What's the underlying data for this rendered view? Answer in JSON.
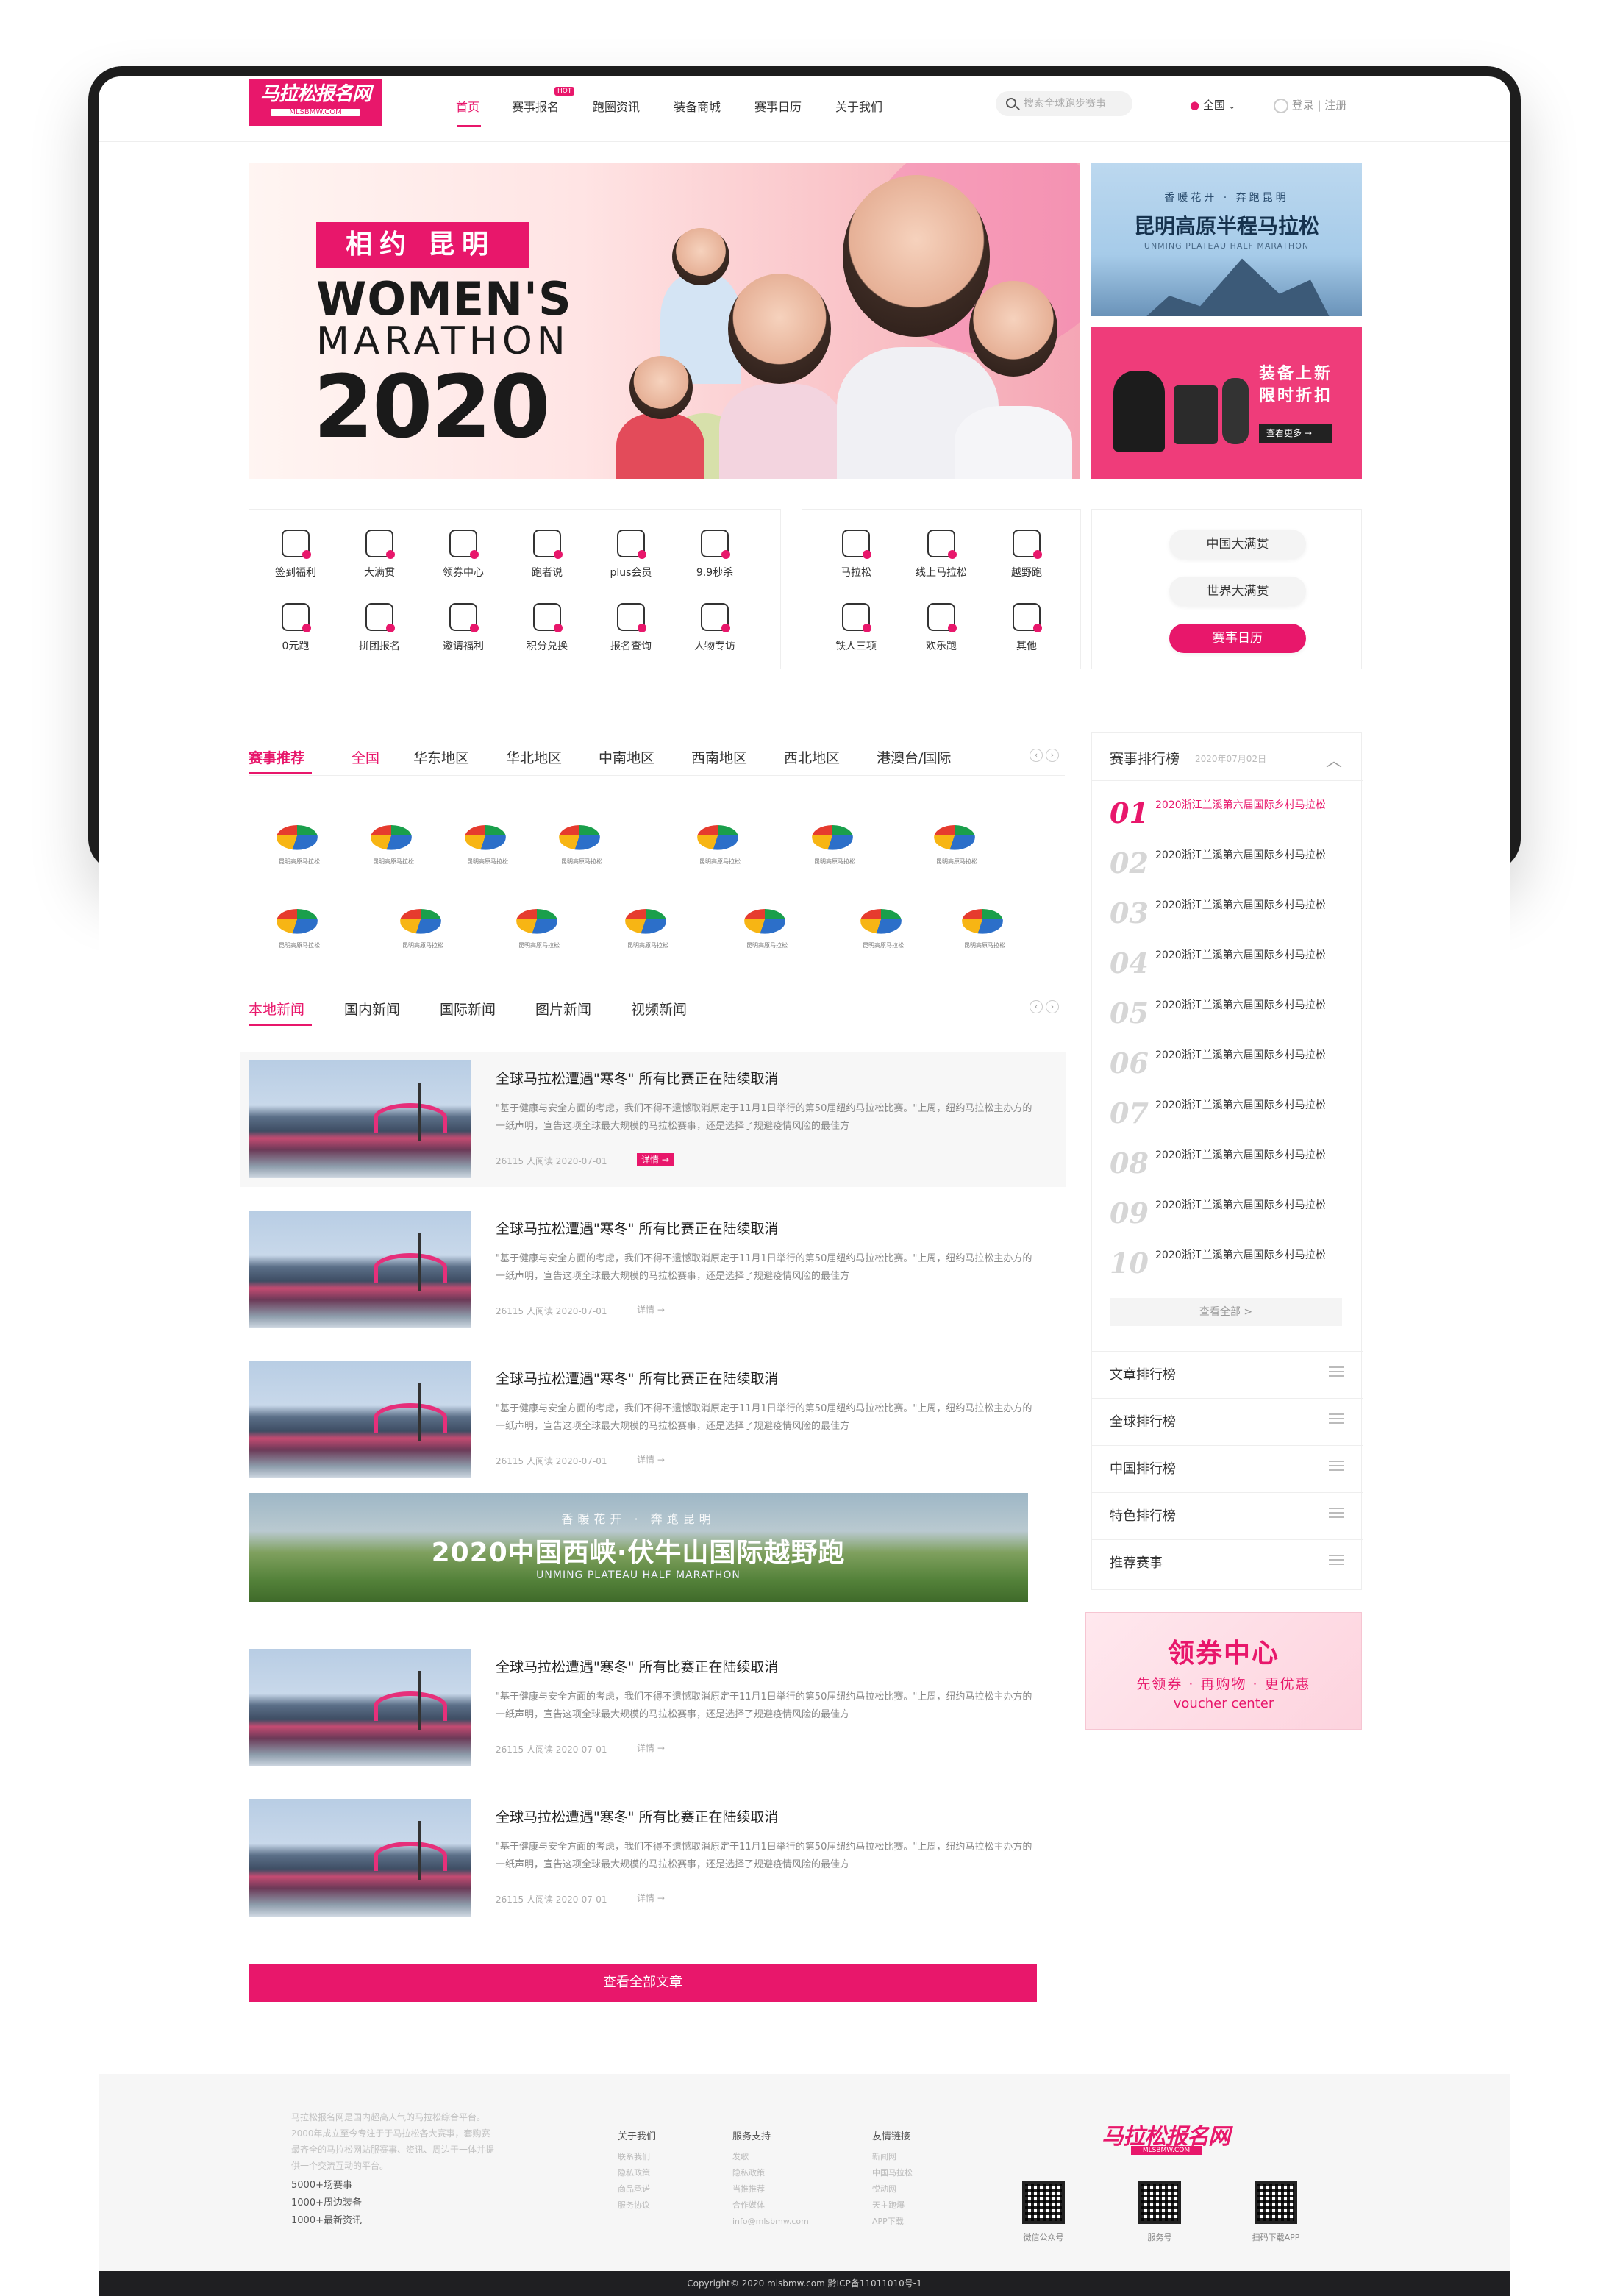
{
  "header": {
    "logo_text": "马拉松报名网",
    "logo_sub": "MLSBMW.COM",
    "nav": [
      "首页",
      "赛事报名",
      "跑圈资讯",
      "装备商城",
      "赛事日历",
      "关于我们"
    ],
    "hot_badge": "HOT",
    "search_placeholder": "搜索全球跑步赛事",
    "location": "全国",
    "login": "登录 | 注册"
  },
  "hero": {
    "tag_left": "相约",
    "tag_right": "昆明",
    "line1": "WOMEN'S",
    "line2": "MARATHON",
    "line3": "2020"
  },
  "side_ads": {
    "ad1_slogan": "香暖花开 · 奔跑昆明",
    "ad1_title": "昆明高原半程马拉松",
    "ad1_sub": "UNMING PLATEAU HALF MARATHON",
    "ad2_line1": "装备上新",
    "ad2_line2": "限时折扣",
    "ad2_btn": "查看更多 →"
  },
  "quick_icons": [
    "签到福利",
    "大满贯",
    "领券中心",
    "跑者说",
    "plus会员",
    "9.9秒杀",
    "0元跑",
    "拼团报名",
    "邀请福利",
    "积分兑换",
    "报名查询",
    "人物专访"
  ],
  "category_icons": [
    "马拉松",
    "线上马拉松",
    "越野跑",
    "铁人三项",
    "欢乐跑",
    "其他"
  ],
  "pills": [
    "中国大满贯",
    "世界大满贯",
    "赛事日历"
  ],
  "races": {
    "title": "赛事推荐",
    "regions": [
      "全国",
      "华东地区",
      "华北地区",
      "中南地区",
      "西南地区",
      "西北地区",
      "港澳台/国际"
    ],
    "logo_caption": "昆明高原马拉松"
  },
  "news_tabs": [
    "本地新闻",
    "国内新闻",
    "国际新闻",
    "图片新闻",
    "视频新闻"
  ],
  "news": {
    "title": "全球马拉松遭遇\"寒冬\" 所有比赛正在陆续取消",
    "desc": "\"基于健康与安全方面的考虑，我们不得不遗憾取消原定于11月1日举行的第50届纽约马拉松比赛。\"上周，纽约马拉松主办方的一纸声明，宣告这项全球最大规模的马拉松赛事，还是选择了规避疫情风险的最佳方",
    "meta": "26115 人阅读      2020-07-01",
    "more": "详情 →"
  },
  "banner": {
    "slogan": "香暖花开 · 奔跑昆明",
    "title": "2020中国西峡·伏牛山国际越野跑",
    "sub": "UNMING PLATEAU HALF MARATHON"
  },
  "view_all": "查看全部文章",
  "ranking": {
    "title": "赛事排行榜",
    "date": "2020年07月02日",
    "numbers": [
      "01",
      "02",
      "03",
      "04",
      "05",
      "06",
      "07",
      "08",
      "09",
      "10"
    ],
    "item": "2020浙江兰溪第六届国际乡村马拉松",
    "view_all": "查看全部 >",
    "lists": [
      "文章排行榜",
      "全球排行榜",
      "中国排行榜",
      "特色排行榜",
      "推荐赛事"
    ]
  },
  "voucher": {
    "title": "领券中心",
    "sub": "先领券 · 再购物 · 更优惠",
    "en": "voucher center"
  },
  "footer": {
    "about": "马拉松报名网是国内超高人气的马拉松综合平台。2000年成立至今专注于于马拉松各大赛事，套购赛最齐全的马拉松网站服赛事、资讯、周边于一体并提供一个交流互动的平台。",
    "stats": [
      "5000+场赛事",
      "1000+周边装备",
      "1000+最新资讯"
    ],
    "col_titles": [
      "关于我们",
      "服务支持",
      "友情链接"
    ],
    "col1": [
      "联系我们",
      "隐私政策",
      "商品承诺",
      "服务协议"
    ],
    "col2": [
      "发歌",
      "隐私政策",
      "当推推荐",
      "合作媒体",
      "info@mlsbmw.com"
    ],
    "col3": [
      "新闻网",
      "中国马拉松",
      "悦动网",
      "天主跑爆",
      "APP下载"
    ],
    "qr_labels": [
      "微信公众号",
      "服务号",
      "扫码下载APP"
    ],
    "copyright": "Copyright© 2020 mlsbmw.com    黔ICP备11011010号-1"
  }
}
